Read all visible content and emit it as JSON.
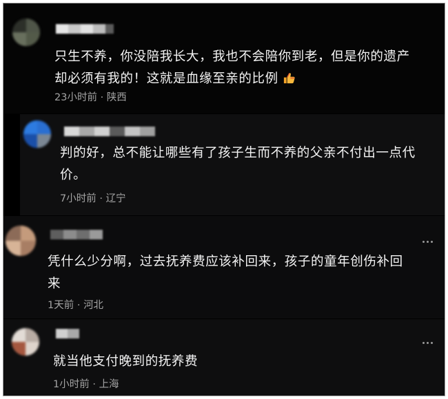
{
  "comments": [
    {
      "lines": [
        "只生不养，你没陪我长大，我也不会陪你到老，但是你的遗产",
        "却必须有我的！这就是血缘至亲的比例"
      ],
      "time": "23小时前",
      "location": "陕西",
      "emoji": "thumbs-up-icon"
    },
    {
      "lines": [
        "判的好，总不能让哪些有了孩子生而不养的父亲不付出一点代",
        "价。"
      ],
      "time": "7小时前",
      "location": "辽宁"
    },
    {
      "lines": [
        "凭什么少分啊，过去抚养费应该补回来，孩子的童年创伤补回",
        "来"
      ],
      "time": "1天前",
      "location": "河北"
    },
    {
      "lines": [
        "就当他支付晚到的抚养费"
      ],
      "time": "1小时前",
      "location": "上海"
    }
  ],
  "separator": "·"
}
